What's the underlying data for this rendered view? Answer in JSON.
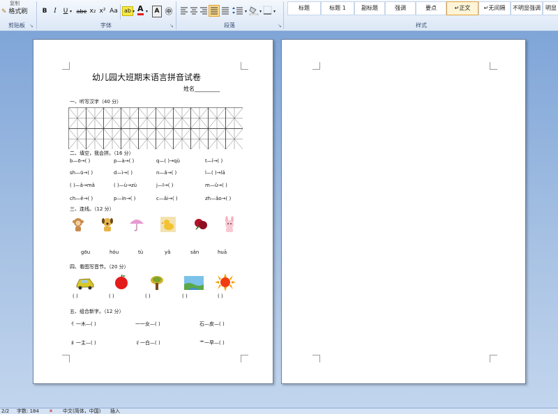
{
  "ribbon": {
    "clipboard": {
      "copy": "复制",
      "format_painter": "格式刷",
      "group": "剪贴板"
    },
    "font": {
      "bold": "B",
      "italic": "I",
      "underline": "U",
      "strike": "abe",
      "sub": "x₂",
      "sup": "x²",
      "case": "Aa",
      "font_color": "A",
      "char_border": "A",
      "enclose": "㊥",
      "group": "字体"
    },
    "paragraph": {
      "group": "段落"
    },
    "styles": {
      "items": [
        "标题",
        "标题 1",
        "副标题",
        "强调",
        "要点",
        "正文",
        "无间隔",
        "不明显强调",
        "明显"
      ],
      "active_index": 5,
      "group": "样式"
    }
  },
  "doc": {
    "title": "幼儿园大班期末语言拼音试卷",
    "name_label": "姓名_________",
    "sec1": "一、听写汉字（40 分）",
    "sec2": "二、填空，我会拼。（16 分）",
    "sec2_rows": [
      [
        "b—ō→(   )",
        "p—à→(   )",
        "q—(   )→qù",
        "t—ǐ→(   )"
      ],
      [
        "sh—ū→(   )",
        "d—ì→(   )",
        "n—ǎ→(   )",
        "l—(   )→lā"
      ],
      [
        "(   )—ǎ→mǎ",
        "(   )—ù→zù",
        "j—ī→(   )",
        "m—ǔ→(   )"
      ],
      [
        "ch—ē→(   )",
        "p—ín→(   )",
        "c—ǎi→(   )",
        "zh—ǎo→(   )"
      ]
    ],
    "sec3": "三、连线。（12 分）",
    "sec3_pinyin": [
      "gōu",
      "hóu",
      "tù",
      "yǎ",
      "sǎn",
      "huā"
    ],
    "sec4": "四、看图写音节。（20 分）",
    "sec4_blanks": [
      "(    )",
      "(    )",
      "(    )",
      "(    )",
      "(    )"
    ],
    "sec5": "五、组合新字。（12 分）",
    "sec5_rows": [
      [
        "亻一木—(   )",
        "一一女—(   )",
        "石—皮—(   )"
      ],
      [
        "纟一主—(   )",
        "彳一白—(   )",
        "艹一早—(   )"
      ]
    ]
  },
  "status": {
    "page": "2/2",
    "words": "字数: 184",
    "lang": "中文(简体，中国)",
    "mode": "插入"
  },
  "colors": {
    "accent": "#e3a23a",
    "ribbon": "#dbe7f6",
    "workspace": "#a9c3e4"
  }
}
